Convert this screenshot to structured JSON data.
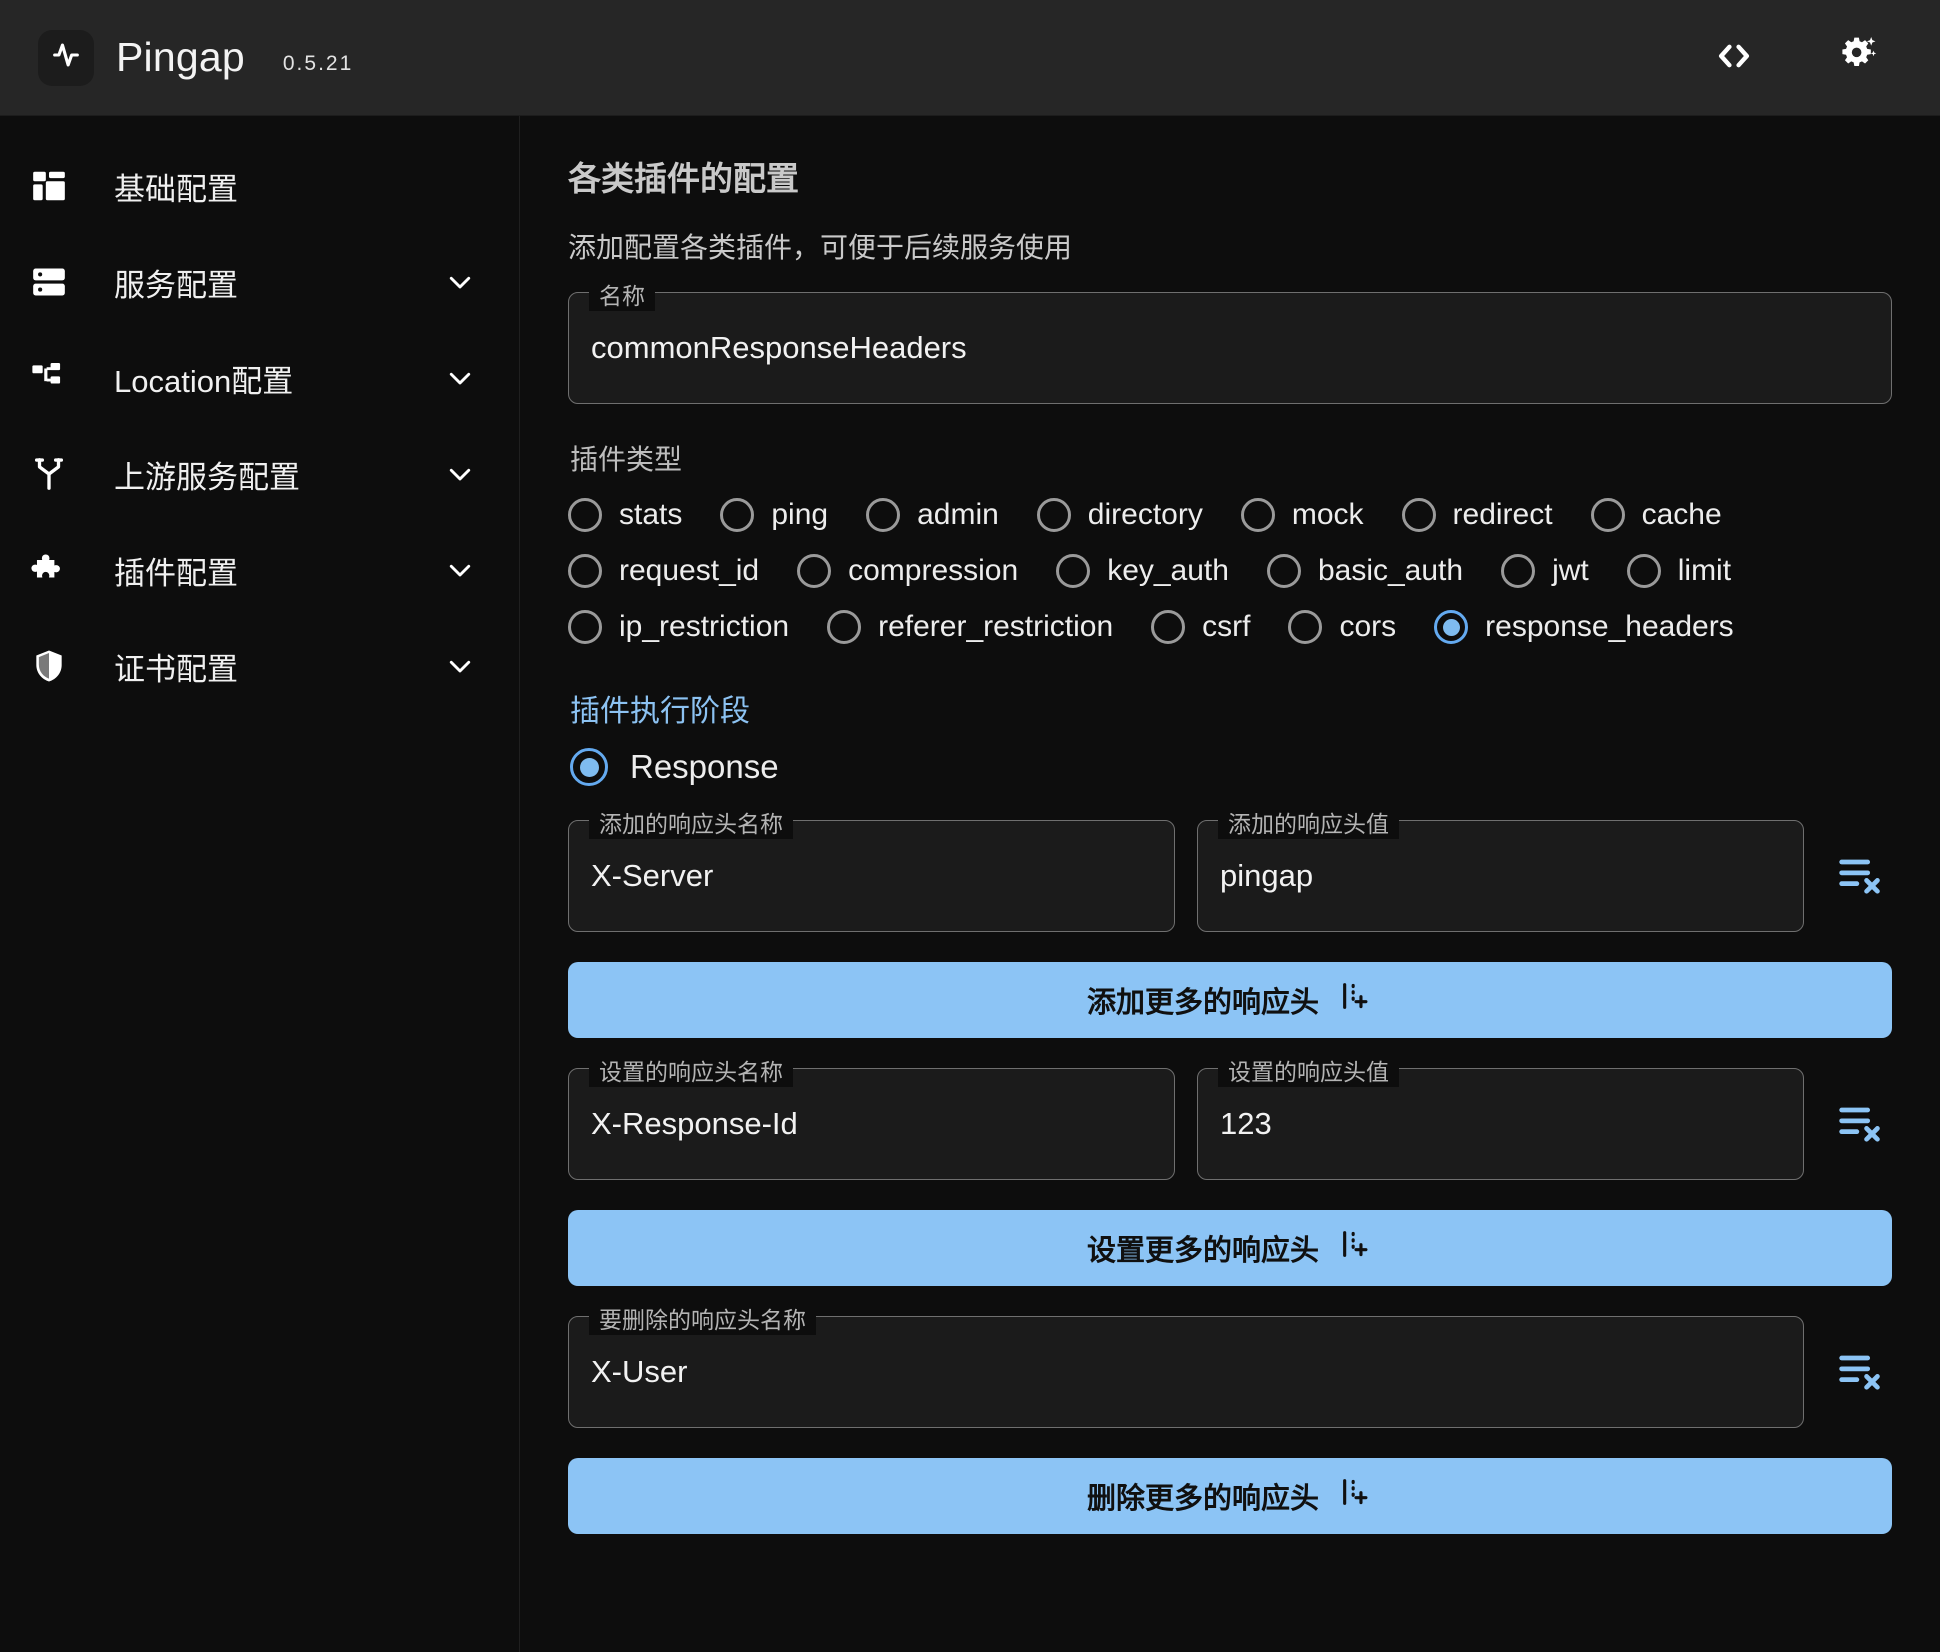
{
  "header": {
    "app_name": "Pingap",
    "version": "0.5.21",
    "logo_icon": "activity-pulse-icon",
    "actions": [
      {
        "icon": "code-brackets-icon",
        "name": "code-view-button"
      },
      {
        "icon": "gear-sparkles-icon",
        "name": "settings-button"
      }
    ]
  },
  "sidebar": {
    "items": [
      {
        "label": "基础配置",
        "icon": "dashboard-icon",
        "expandable": false
      },
      {
        "label": "服务配置",
        "icon": "server-icon",
        "expandable": true
      },
      {
        "label": "Location配置",
        "icon": "network-tree-icon",
        "expandable": true
      },
      {
        "label": "上游服务配置",
        "icon": "git-branch-icon",
        "expandable": true
      },
      {
        "label": "插件配置",
        "icon": "puzzle-icon",
        "expandable": true
      },
      {
        "label": "证书配置",
        "icon": "shield-icon",
        "expandable": true
      }
    ]
  },
  "main": {
    "title": "各类插件的配置",
    "subtitle": "添加配置各类插件，可便于后续服务使用",
    "name_field": {
      "legend": "名称",
      "value": "commonResponseHeaders"
    },
    "plugin_type": {
      "label": "插件类型",
      "selected": "response_headers",
      "rows": [
        [
          "stats",
          "ping",
          "admin",
          "directory",
          "mock",
          "redirect",
          "cache"
        ],
        [
          "request_id",
          "compression",
          "key_auth",
          "basic_auth",
          "jwt",
          "limit"
        ],
        [
          "ip_restriction",
          "referer_restriction",
          "csrf",
          "cors",
          "response_headers"
        ]
      ]
    },
    "stage": {
      "label": "插件执行阶段",
      "options": [
        "Response"
      ],
      "selected": "Response"
    },
    "add_header": {
      "name_legend": "添加的响应头名称",
      "name_value": "X-Server",
      "value_legend": "添加的响应头值",
      "value_value": "pingap",
      "remove_icon": "list-x-icon",
      "button_label": "添加更多的响应头",
      "button_icon": "list-plus-icon"
    },
    "set_header": {
      "name_legend": "设置的响应头名称",
      "name_value": "X-Response-Id",
      "value_legend": "设置的响应头值",
      "value_value": "123",
      "remove_icon": "list-x-icon",
      "button_label": "设置更多的响应头",
      "button_icon": "list-plus-icon"
    },
    "remove_header": {
      "name_legend": "要删除的响应头名称",
      "name_value": "X-User",
      "remove_icon": "list-x-icon",
      "button_label": "删除更多的响应头",
      "button_icon": "list-plus-icon"
    }
  },
  "colors": {
    "accent": "#8cc4f5",
    "radio_accent": "#7fbcf0",
    "header_bg": "#262626",
    "page_bg": "#0d0d0d",
    "field_bg": "#1b1b1b"
  }
}
